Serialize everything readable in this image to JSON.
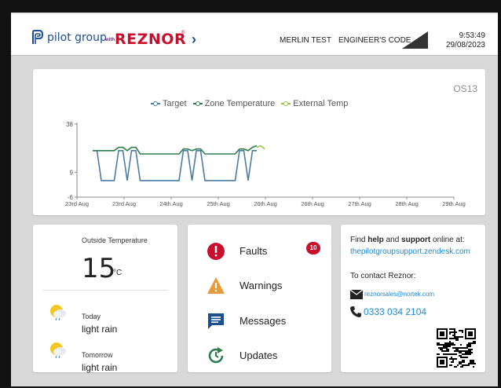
{
  "header": {
    "pilot_logo_text": "pilot group",
    "with_text": "with",
    "brand_text": "REZNOR",
    "brand_reg": "®",
    "site_name": "MERLIN TEST",
    "engineer_label": "ENGINEER'S CODE",
    "time": "9:53:49",
    "date": "29/08/2023"
  },
  "chart": {
    "unit_id": "OS13"
  },
  "chart_data": {
    "type": "line",
    "title": "",
    "legend_position": "top-center",
    "x_tick_labels": [
      "23rd Aug",
      "23rd Aug",
      "24th Aug",
      "25th Aug",
      "26th Aug",
      "26th Aug",
      "27th Aug",
      "28th Aug",
      "29th Aug"
    ],
    "y_ticks": [
      38,
      9,
      -6
    ],
    "ylim": [
      -6,
      38
    ],
    "series": [
      {
        "name": "Target",
        "color": "#4b7ca6",
        "values": [
          22,
          22,
          4,
          4,
          4,
          4,
          22,
          22,
          4,
          22,
          22,
          4,
          4,
          4,
          4,
          4,
          4,
          4,
          4,
          4,
          4,
          22,
          22,
          4,
          22,
          22,
          4,
          4,
          4,
          4,
          4,
          4,
          4,
          4,
          22,
          22,
          4,
          22,
          22
        ]
      },
      {
        "name": "Zone Temperature",
        "color": "#2e7d4d",
        "values": [
          22,
          22,
          22,
          22,
          22,
          22,
          24,
          24,
          22,
          24,
          24,
          20,
          20,
          20,
          20,
          20,
          20,
          20,
          20,
          20,
          20,
          23,
          23,
          22,
          23,
          23,
          20,
          20,
          20,
          20,
          20,
          20,
          20,
          20,
          23,
          23,
          22,
          24,
          25
        ]
      },
      {
        "name": "External Temp",
        "color": "#9cc54a",
        "values": [
          24,
          25,
          23
        ]
      }
    ]
  },
  "outside": {
    "label": "Outside Temperature",
    "value": "15",
    "unit": "°C",
    "today_label": "Today",
    "today_value": "light rain",
    "tomorrow_label": "Tomorrow",
    "tomorrow_value": "light rain"
  },
  "alerts": {
    "faults_label": "Faults",
    "faults_count": "10",
    "warnings_label": "Warnings",
    "messages_label": "Messages",
    "updates_label": "Updates"
  },
  "support": {
    "intro_pre": "Find ",
    "intro_help": "help",
    "intro_mid": " and ",
    "intro_support": "support",
    "intro_post": " online at:",
    "link": "thepilotgroupsupport.zendesk.com",
    "contact_label": "To contact Reznor:",
    "email": "reznorsales@nortek.com",
    "phone": "0333 034 2104"
  }
}
